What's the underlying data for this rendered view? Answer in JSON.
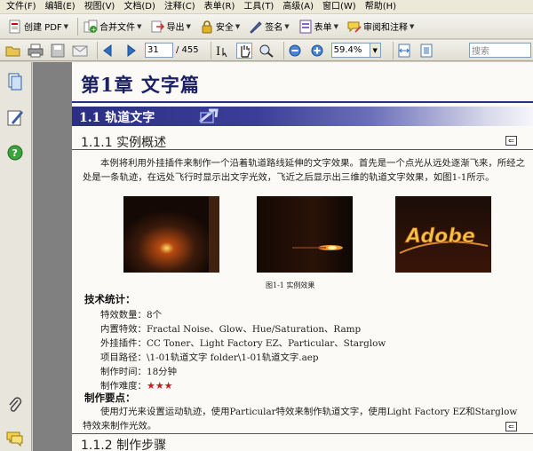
{
  "menu": [
    "文件(F)",
    "编辑(E)",
    "视图(V)",
    "文档(D)",
    "注释(C)",
    "表单(R)",
    "工具(T)",
    "高级(A)",
    "窗口(W)",
    "帮助(H)"
  ],
  "toolbar1": {
    "create_pdf": "创建 PDF",
    "merge_files": "合并文件",
    "export": "导出",
    "security": "安全",
    "sign": "签名",
    "forms": "表单",
    "review_comment": "审阅和注释"
  },
  "toolbar2": {
    "current_page": "31",
    "total_pages": "/ 455",
    "zoom": "59.4%",
    "search_placeholder": "搜索"
  },
  "document": {
    "chapter_title": "第1章   文字篇",
    "section_title": "1.1  轨道文字",
    "sub1_title": "1.1.1   实例概述",
    "intro_para": "本例将利用外挂插件来制作一个沿着轨道路线延伸的文字效果。首先是一个点光从远处逐渐飞来，所经之处是一条轨迹，在远处飞行时显示出文字光效，飞近之后显示出三维的轨道文字效果，如图1-1所示。",
    "figure_caption": "图1-1   实例效果",
    "figure3_text": "Adobe",
    "tech_head": "技术统计：",
    "stats": [
      "特效数量：8个",
      "内置特效：Fractal Noise、Glow、Hue/Saturation、Ramp",
      "外挂插件：CC Toner、Light Factory EZ、Particular、Starglow",
      "项目路径：\\1-01轨道文字 folder\\1-01轨道文字.aep",
      "制作时间：18分钟"
    ],
    "difficulty_label": "制作难度：",
    "difficulty_stars": "★★★",
    "key_points_head": "制作要点：",
    "key_points_para": "使用灯光来设置运动轨迹，使用Particular特效来制作轨道文字，使用Light Factory EZ和Starglow特效来制作光效。",
    "sub2_title": "1.1.2   制作步骤"
  },
  "colors": {
    "chapter_blue": "#1b1f66",
    "section_bar": "#2b2f83",
    "stars_red": "#c61c1c",
    "viewer_gray": "#808080"
  }
}
